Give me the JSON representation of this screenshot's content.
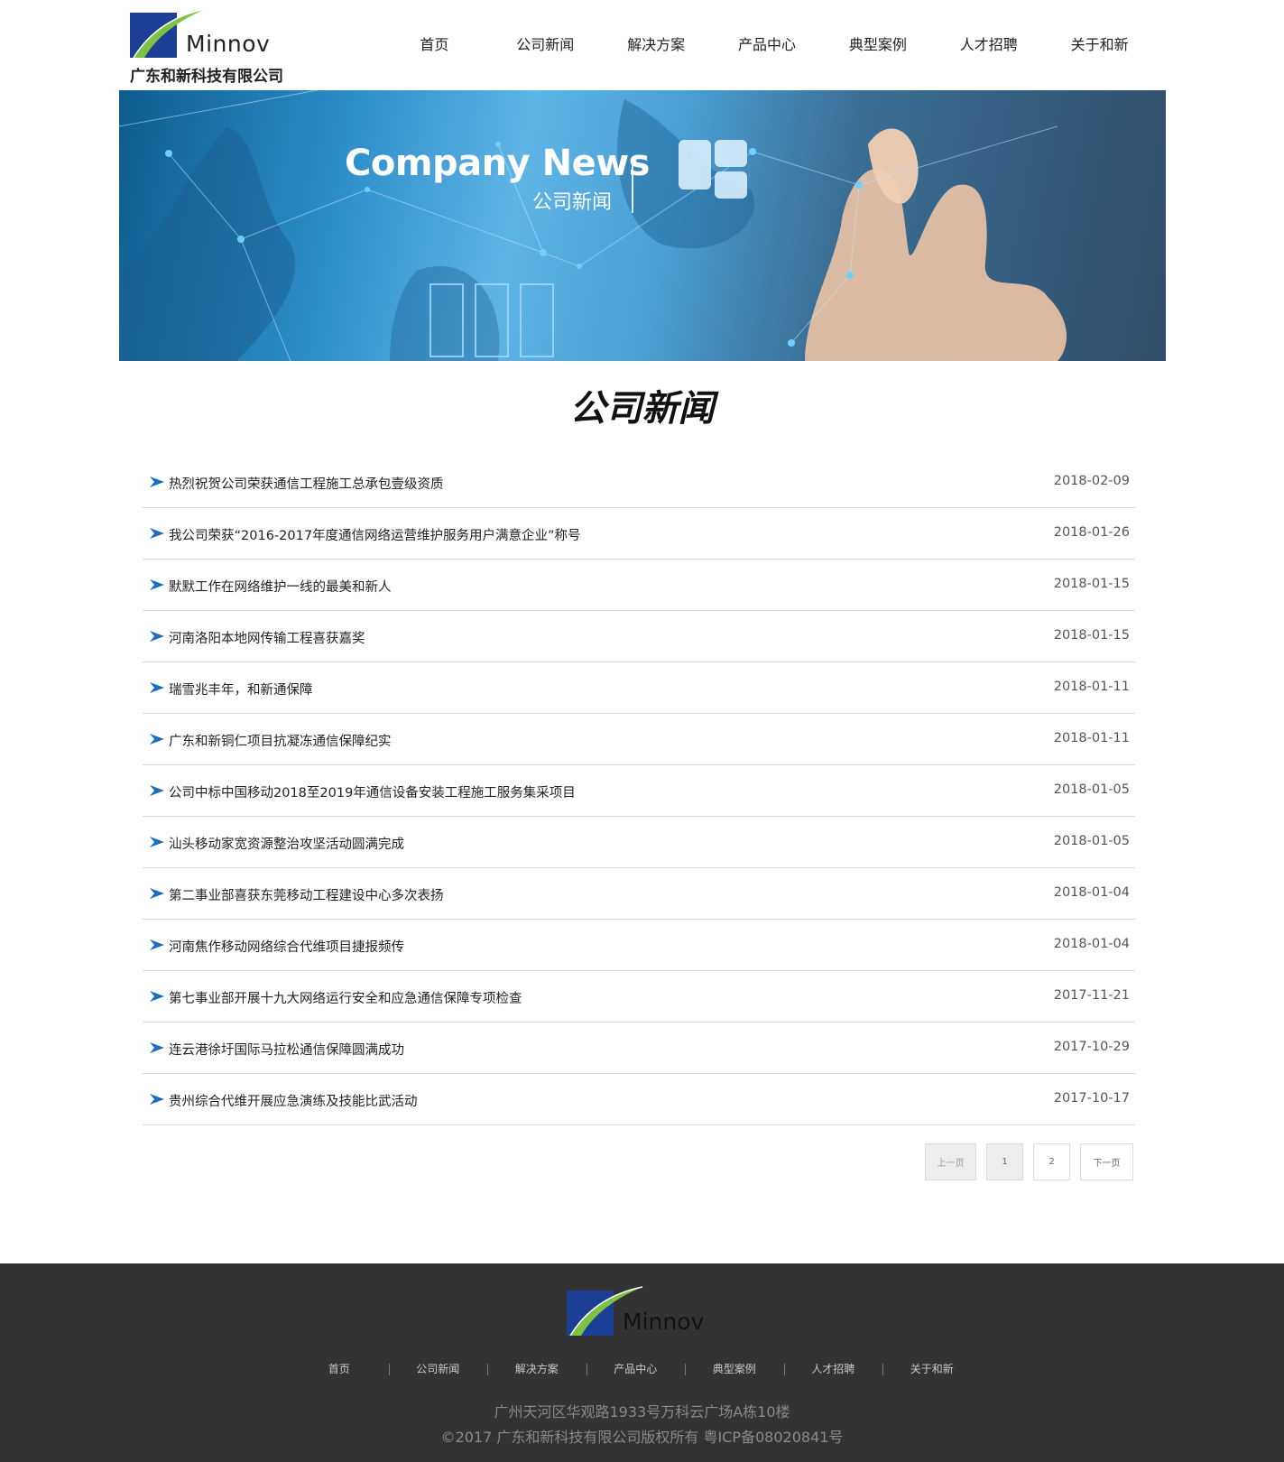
{
  "header": {
    "logo_word": "Minnov",
    "company_name": "广东和新科技有限公司",
    "nav": [
      "首页",
      "公司新闻",
      "解决方案",
      "产品中心",
      "典型案例",
      "人才招聘",
      "关于和新"
    ]
  },
  "banner": {
    "title_en": "Company News",
    "title_cn": "公司新闻"
  },
  "section_title": "公司新闻",
  "news": [
    {
      "title": "热烈祝贺公司荣获通信工程施工总承包壹级资质",
      "date": "2018-02-09"
    },
    {
      "title": "我公司荣获“2016-2017年度通信网络运营维护服务用户满意企业”称号",
      "date": "2018-01-26"
    },
    {
      "title": "默默工作在网络维护一线的最美和新人",
      "date": "2018-01-15"
    },
    {
      "title": "河南洛阳本地网传输工程喜获嘉奖",
      "date": "2018-01-15"
    },
    {
      "title": "瑞雪兆丰年，和新通保障",
      "date": "2018-01-11"
    },
    {
      "title": "广东和新铜仁项目抗凝冻通信保障纪实",
      "date": "2018-01-11"
    },
    {
      "title": "公司中标中国移动2018至2019年通信设备安装工程施工服务集采项目",
      "date": "2018-01-05"
    },
    {
      "title": "汕头移动家宽资源整治攻坚活动圆满完成",
      "date": "2018-01-05"
    },
    {
      "title": "第二事业部喜获东莞移动工程建设中心多次表扬",
      "date": "2018-01-04"
    },
    {
      "title": "河南焦作移动网络综合代维项目捷报频传",
      "date": "2018-01-04"
    },
    {
      "title": "第七事业部开展十九大网络运行安全和应急通信保障专项检查",
      "date": "2017-11-21"
    },
    {
      "title": "连云港徐圩国际马拉松通信保障圆满成功",
      "date": "2017-10-29"
    },
    {
      "title": "贵州综合代维开展应急演练及技能比武活动",
      "date": "2017-10-17"
    }
  ],
  "pagination": {
    "prev": "上一页",
    "pages": [
      "1",
      "2"
    ],
    "next": "下一页",
    "current": "1"
  },
  "footer": {
    "logo_word": "Minnov",
    "nav": [
      "首页",
      "公司新闻",
      "解决方案",
      "产品中心",
      "典型案例",
      "人才招聘",
      "关于和新"
    ],
    "address": "广州天河区华观路1933号万科云广场A栋10楼",
    "copyright": "©2017 广东和新科技有限公司版权所有   粤ICP备08020841号"
  },
  "colors": {
    "logo_blue": "#1b3f95",
    "logo_green": "#7dc242",
    "arrow_blue": "#1a6fc0",
    "footer_bg": "#333333",
    "banner_blue": "#3b9be0"
  }
}
